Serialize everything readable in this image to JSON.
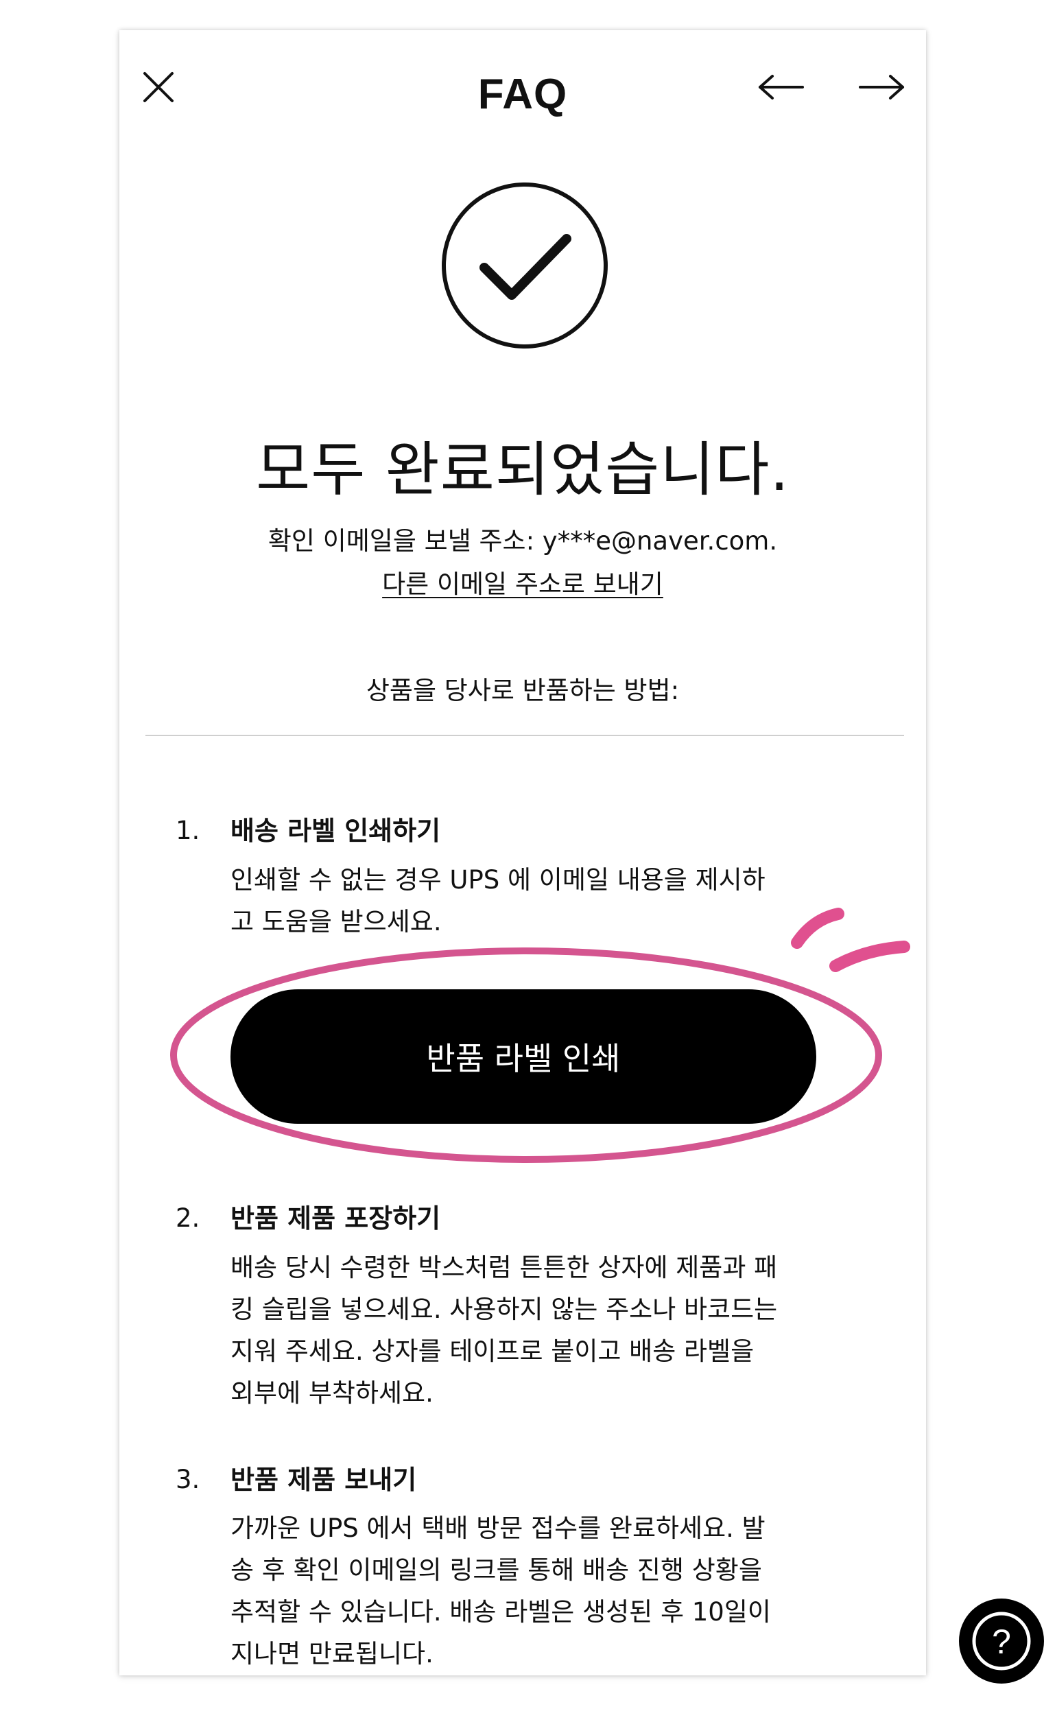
{
  "header": {
    "title": "FAQ",
    "close_icon": "close-icon",
    "back_icon": "arrow-left-icon",
    "forward_icon": "arrow-right-icon"
  },
  "success": {
    "icon": "check-circle-icon",
    "headline": "모두 완료되었습니다.",
    "confirm_text": "확인 이메일을 보낼 주소: y***e@naver.com.",
    "resend_link": "다른 이메일 주소로 보내기"
  },
  "howto": {
    "heading": "상품을 당사로 반품하는 방법:"
  },
  "steps": [
    {
      "number": "1.",
      "title": "배송 라벨 인쇄하기",
      "lines": [
        "인쇄할 수 없는 경우 UPS 에 이메일 내용을 제시하",
        "고 도움을 받으세요."
      ]
    },
    {
      "number": "2.",
      "title": "반품 제품 포장하기",
      "lines": [
        "배송 당시 수령한 박스처럼 튼튼한 상자에 제품과 패",
        "킹 슬립을 넣으세요. 사용하지 않는 주소나 바코드는",
        "지워 주세요. 상자를 테이프로 붙이고 배송 라벨을",
        "외부에 부착하세요."
      ]
    },
    {
      "number": "3.",
      "title": "반품 제품 보내기",
      "lines": [
        "가까운 UPS 에서 택배 방문 접수를 완료하세요. 발",
        "송 후 확인 이메일의 링크를 통해 배송 진행 상황을",
        "추적할 수 있습니다. 배송 라벨은 생성된 후 10일이",
        "지나면 만료됩니다."
      ]
    }
  ],
  "print_button": {
    "label": "반품 라벨 인쇄"
  },
  "help_button": {
    "icon": "question-mark-icon",
    "glyph": "?"
  },
  "colors": {
    "highlight": "#d4558f",
    "button_bg": "#000000",
    "text": "#111111"
  }
}
